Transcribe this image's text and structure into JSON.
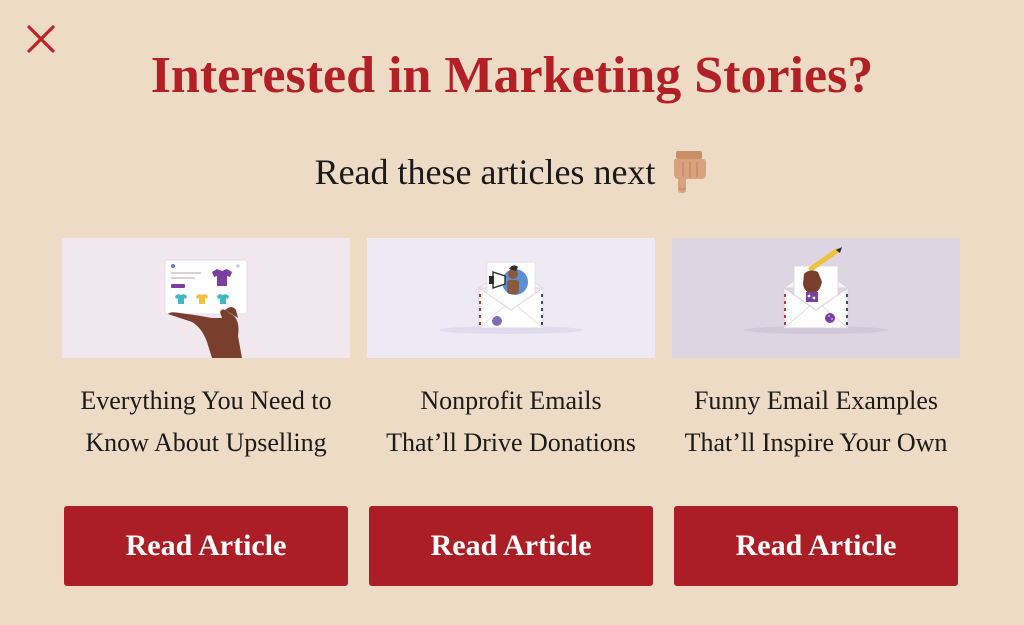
{
  "modal": {
    "title": "Interested in Marketing Stories?",
    "subtitle": "Read these articles next",
    "close_icon": "close-icon",
    "pointer_emoji": "👇"
  },
  "articles": [
    {
      "title_line1": "Everything You Need to",
      "title_line2": "Know About Upselling",
      "button_label": "Read Article",
      "image_icon": "hand-holding-card-illustration",
      "image_bg": "#f1e8ef"
    },
    {
      "title_line1": "Nonprofit Emails",
      "title_line2": "That’ll Drive Donations",
      "button_label": "Read Article",
      "image_icon": "envelope-with-person-illustration",
      "image_bg": "#edeaf6"
    },
    {
      "title_line1": "Funny Email Examples",
      "title_line2": "That’ll Inspire Your Own",
      "button_label": "Read Article",
      "image_icon": "envelope-with-hand-pencil-illustration",
      "image_bg": "#ddd6e2"
    }
  ],
  "colors": {
    "background": "#eddbc5",
    "accent": "#ac1e25",
    "title": "#b22026"
  }
}
